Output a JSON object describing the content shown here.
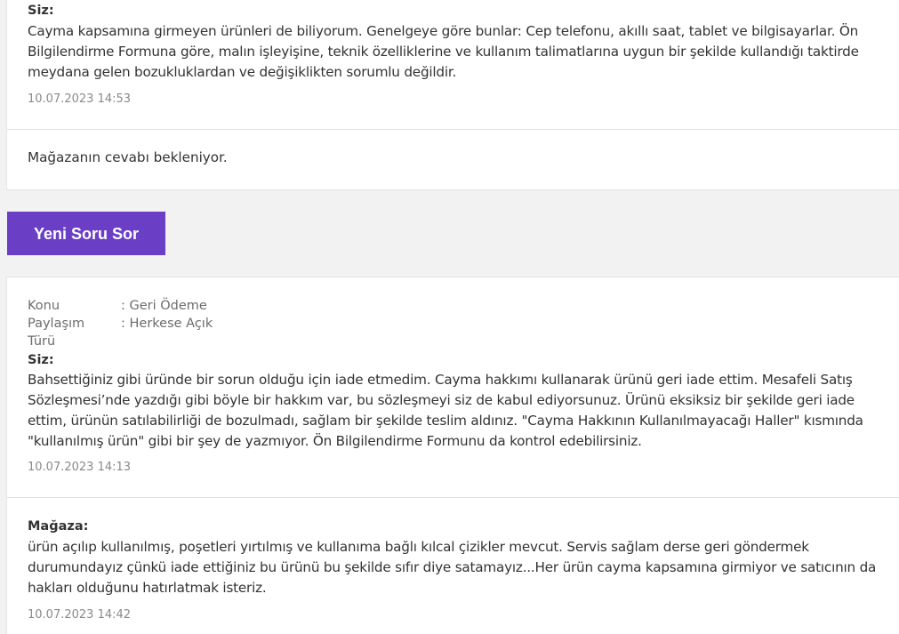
{
  "first_thread": {
    "question": {
      "author": "Siz:",
      "text": "Cayma kapsamına girmeyen ürünleri de biliyorum. Genelgeye göre bunlar: Cep telefonu, akıllı saat, tablet ve bilgisayarlar. Ön Bilgilendirme Formuna göre, malın işleyişine, teknik özelliklerine ve kullanım talimatlarına uygun bir şekilde kullandığı taktirde meydana gelen bozukluklardan ve değişiklikten sorumlu değildir.",
      "timestamp": "10.07.2023 14:53"
    },
    "status": "Mağazanın cevabı bekleniyor."
  },
  "new_question_button": "Yeni Soru Sor",
  "second_thread": {
    "meta": {
      "subject_label": "Konu",
      "subject_value": ": Geri Ödeme",
      "share_label": "Paylaşım Türü",
      "share_value": ": Herkese Açık"
    },
    "question": {
      "author": "Siz:",
      "text": "Bahsettiğiniz gibi üründe bir sorun olduğu için iade etmedim. Cayma hakkımı kullanarak ürünü geri iade ettim. Mesafeli Satış Sözleşmesi’nde yazdığı gibi böyle bir hakkım var, bu sözleşmeyi siz de kabul ediyorsunuz. Ürünü eksiksiz bir şekilde geri iade ettim, ürünün satılabilirliği de bozulmadı, sağlam bir şekilde teslim aldınız. \"Cayma Hakkının Kullanılmayacağı Haller\" kısmında \"kullanılmış ürün\" gibi bir şey de yazmıyor. Ön Bilgilendirme Formunu da kontrol edebilirsiniz.",
      "timestamp": "10.07.2023 14:13"
    },
    "answer": {
      "author": "Mağaza:",
      "text": "ürün açılıp kullanılmış, poşetleri yırtılmış ve kullanıma bağlı kılcal çizikler mevcut. Servis sağlam derse geri göndermek durumundayız çünkü iade ettiğiniz bu ürünü bu şekilde sıfır diye satamayız...Her ürün cayma kapsamına girmiyor ve satıcının da hakları olduğunu hatırlatmak isteriz.",
      "timestamp": "10.07.2023 14:42"
    }
  },
  "colors": {
    "button_bg": "#6a3fc6",
    "page_bg": "#f2f2f2",
    "timestamp": "#8a8a8a"
  }
}
